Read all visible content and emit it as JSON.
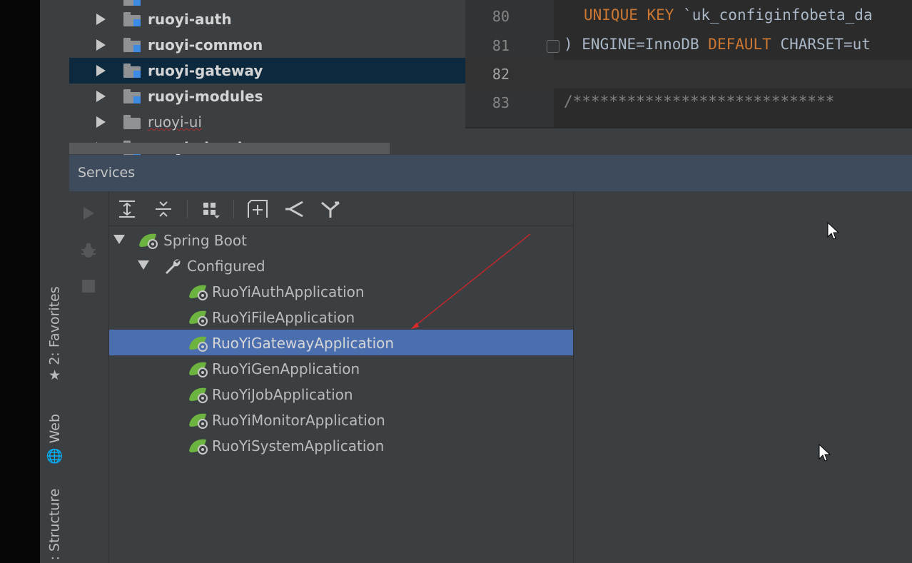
{
  "project_tree": {
    "items": [
      {
        "label": "ruoyi-auth",
        "bold": true,
        "selected": false
      },
      {
        "label": "ruoyi-common",
        "bold": true,
        "selected": false
      },
      {
        "label": "ruoyi-gateway",
        "bold": true,
        "selected": true
      },
      {
        "label": "ruoyi-modules",
        "bold": true,
        "selected": false
      },
      {
        "label": "ruoyi-ui",
        "bold": false,
        "selected": false
      },
      {
        "label": "ruoyi-visual",
        "bold": true,
        "selected": false
      }
    ]
  },
  "editor": {
    "lines": [
      {
        "num": "80",
        "kw": "UNIQUE KEY",
        "text": " `uk_configinfobeta_da"
      },
      {
        "num": "81",
        "text_a": ") ENGINE=InnoDB ",
        "kw": "DEFAULT",
        "text_b": " CHARSET=ut"
      },
      {
        "num": "82",
        "text": ""
      },
      {
        "num": "83",
        "text": "/*****************************"
      }
    ]
  },
  "left_toolbar": {
    "favorites": "2: Favorites",
    "web": "Web",
    "structure": ": Structure"
  },
  "services": {
    "title": "Services",
    "root": "Spring Boot",
    "group": "Configured",
    "apps": [
      "RuoYiAuthApplication",
      "RuoYiFileApplication",
      "RuoYiGatewayApplication",
      "RuoYiGenApplication",
      "RuoYiJobApplication",
      "RuoYiMonitorApplication",
      "RuoYiSystemApplication"
    ],
    "selected_index": 2
  },
  "colors": {
    "selection": "#4b6eaf",
    "keyword": "#cc7832",
    "spring_green": "#6db33f",
    "header": "#3d4b5c"
  }
}
